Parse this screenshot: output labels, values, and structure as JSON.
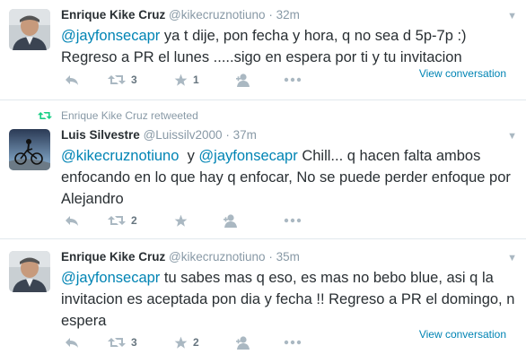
{
  "tweets": [
    {
      "name": "Enrique Kike Cruz",
      "handle": "@kikecruznotiuno",
      "time": "· 32m",
      "text_lines": [
        [
          {
            "m": "@jayfonsecapr"
          },
          {
            "t": " ya t dije, pon fecha y hora, q no sea d 5p-7p :)"
          }
        ],
        [
          {
            "t": "Regreso a PR el lunes .....sigo en espera por ti y tu invitacion"
          }
        ]
      ],
      "retweets": "3",
      "favorites": "1",
      "view_conversation": "View conversation"
    },
    {
      "retweet_context": "Enrique Kike Cruz retweeted",
      "name": "Luis Silvestre",
      "handle": "@Luissilv2000",
      "time": "· 37m",
      "text_lines": [
        [
          {
            "m": "@kikecruznotiuno"
          },
          {
            "t": "  y "
          },
          {
            "m": "@jayfonsecapr"
          },
          {
            "t": " Chill... q hacen falta ambos"
          }
        ],
        [
          {
            "t": "enfocando en lo que hay q enfocar, No se puede perder enfoque por"
          }
        ],
        [
          {
            "t": "Alejandro"
          }
        ]
      ],
      "retweets": "2",
      "favorites": "",
      "view_conversation": ""
    },
    {
      "name": "Enrique Kike Cruz",
      "handle": "@kikecruznotiuno",
      "time": "· 35m",
      "text_lines": [
        [
          {
            "m": "@jayfonsecapr"
          },
          {
            "t": " tu sabes mas q eso, es mas no bebo blue, asi q la"
          }
        ],
        [
          {
            "t": "invitacion es aceptada pon dia y fecha !! Regreso a PR el domingo, n"
          }
        ],
        [
          {
            "t": "espera"
          }
        ]
      ],
      "retweets": "3",
      "favorites": "2",
      "view_conversation": "View conversation"
    }
  ],
  "colors": {
    "mention": "#0084b4",
    "icon": "#aab8c2",
    "retweet_green": "#19cf86",
    "separator": "#e1e8ed"
  }
}
